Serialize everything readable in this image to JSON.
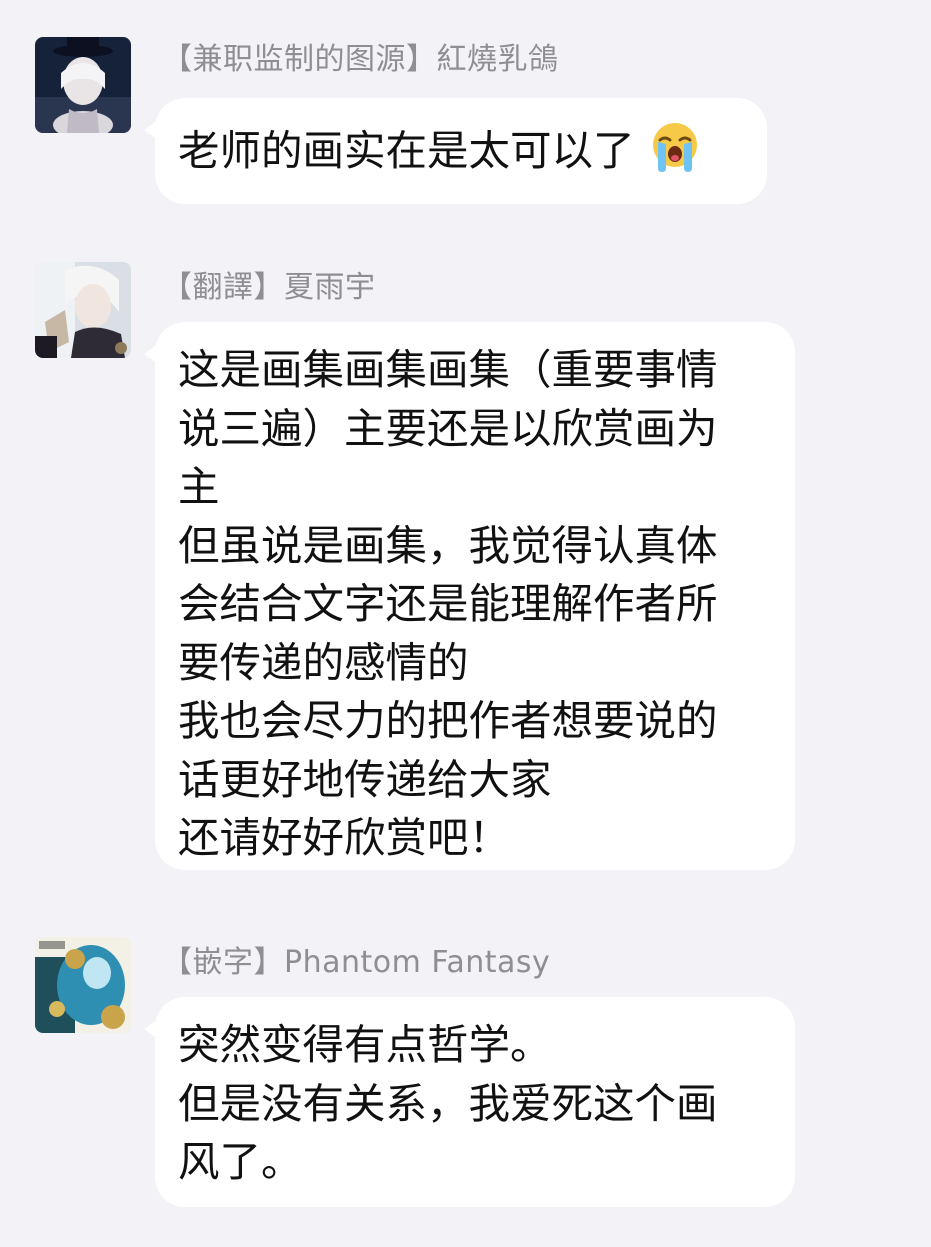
{
  "messages": [
    {
      "sender": "【兼职监制的图源】紅燒乳鴿",
      "lines": [
        "老师的画实在是太可以了"
      ],
      "emoji": "loudly-crying-face"
    },
    {
      "sender": "【翻譯】夏雨宇",
      "lines": [
        "这是画集画集画集（重要事情",
        "说三遍）主要还是以欣赏画为",
        "主",
        "但虽说是画集，我觉得认真体",
        "会结合文字还是能理解作者所",
        "要传递的感情的",
        "我也会尽力的把作者想要说的",
        "话更好地传递给大家",
        "还请好好欣赏吧！"
      ]
    },
    {
      "sender": "【嵌字】Phantom Fantasy",
      "lines": [
        "突然变得有点哲学。",
        "但是没有关系，我爱死这个画",
        "风了。"
      ]
    }
  ]
}
